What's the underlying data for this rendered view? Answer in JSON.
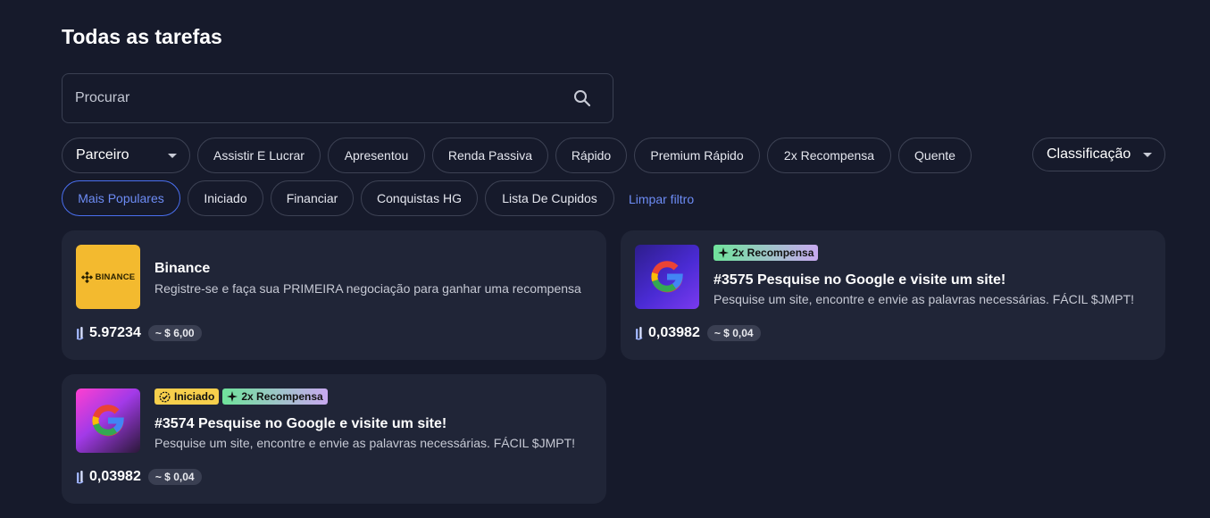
{
  "page": {
    "title": "Todas as tarefas"
  },
  "search": {
    "placeholder": "Procurar"
  },
  "filters": {
    "partner_label": "Parceiro",
    "sort_label": "Classificação",
    "row1": [
      "Assistir E Lucrar",
      "Apresentou",
      "Renda Passiva",
      "Rápido",
      "Premium Rápido",
      "2x Recompensa",
      "Quente"
    ],
    "row2": [
      "Mais Populares",
      "Iniciado",
      "Financiar",
      "Conquistas HG",
      "Lista De Cupidos"
    ],
    "active": "Mais Populares",
    "clear_label": "Limpar filtro"
  },
  "tasks": [
    {
      "name": "Binance",
      "description": "Registre-se e faça sua PRIMEIRA negociação para ganhar uma recompensa",
      "amount": "5.97234",
      "usd": "~ $ 6,00",
      "logo_text": "BINANCE",
      "badges": []
    },
    {
      "name": "#3575 Pesquise no Google e visite um site!",
      "description": "Pesquise um site, encontre e envie as palavras necessárias. FÁCIL $JMPT!",
      "amount": "0,03982",
      "usd": "~ $ 0,04",
      "badges": [
        "2x Recompensa"
      ]
    },
    {
      "name": "#3574 Pesquise no Google e visite um site!",
      "description": "Pesquise um site, encontre e envie as palavras necessárias. FÁCIL $JMPT!",
      "amount": "0,03982",
      "usd": "~ $ 0,04",
      "badges": [
        "Iniciado",
        "2x Recompensa"
      ]
    }
  ],
  "colors": {
    "background": "#161a2b",
    "card": "#202537",
    "accent": "#6d8cf5",
    "badge_started": "#f7cf4c",
    "binance_yellow": "#f3ba2f"
  }
}
